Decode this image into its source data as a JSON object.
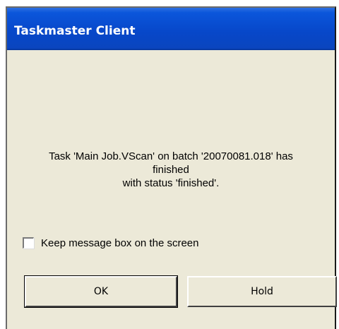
{
  "window": {
    "title": "Taskmaster Client"
  },
  "message": {
    "line1": "Task 'Main Job.VScan' on batch '20070081.018' has",
    "line2": "finished",
    "line3": "with status 'finished'."
  },
  "checkbox": {
    "label": "Keep message box on the screen",
    "checked": false
  },
  "buttons": {
    "ok_label": "OK",
    "hold_label": "Hold"
  },
  "colors": {
    "titlebar": "#0a4fd4",
    "dialog_bg": "#ece9d8",
    "title_text": "#ffffff"
  }
}
